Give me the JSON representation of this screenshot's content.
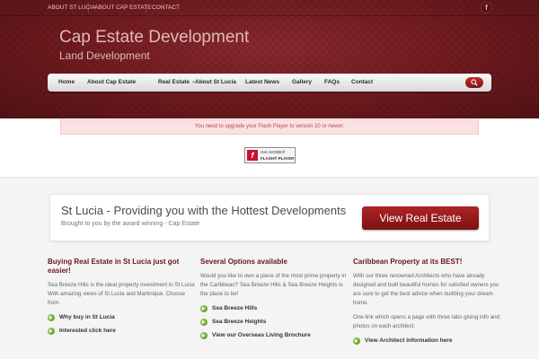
{
  "topbar": {
    "links": [
      "ABOUT ST LUCIA",
      "ABOUT CAP ESTATE",
      "CONTACT"
    ],
    "social_icon": "facebook-icon"
  },
  "site": {
    "title": "Cap Estate Development",
    "subtitle": "Land Development"
  },
  "nav": {
    "items": [
      "Home",
      "About Cap Estate",
      "Real Estate",
      "About St Lucia",
      "Latest News",
      "Gallery",
      "FAQs",
      "Contact"
    ],
    "search_icon": "search-icon"
  },
  "flash": {
    "message": "You need to upgrade your Flash Player to version 10 or newer.",
    "badge_get": "Get ADOBE®",
    "badge_name": "FLASH® PLAYER"
  },
  "promo": {
    "title": "St Lucia - Providing you with the Hottest Developments",
    "subtitle": "Brought to you by the award winning - Cap Estate",
    "button": "View Real Estate"
  },
  "columns": [
    {
      "title": "Buying Real Estate in St Lucia just got easier!",
      "paragraphs": [
        "Sea Breeze Hills is the ideal property investment in St Lucia With amazing views of St Lucia and Martinique. Choose from."
      ],
      "links": [
        "Why buy in St Lucia",
        "Interested click here"
      ]
    },
    {
      "title": "Several Options available",
      "paragraphs": [
        "Would you like to own a piece of the most prime property in the Caribbean? Sea Breeze Hills & Sea Breeze Heights is the place to be!"
      ],
      "links": [
        "Sea Breeze Hills",
        "Sea Breeze Heights",
        "View our Overseas Living Brochure"
      ]
    },
    {
      "title": "Caribbean Property at its BEST!",
      "paragraphs": [
        "With our three renowned Architects who have already designed and built beautiful homes for satisfied owners you are sure to get the best advice when building your dream home.",
        "One link which opens a page with three tabs giving info and photos on each architect."
      ],
      "links": [
        "View Architect information here"
      ]
    }
  ],
  "colors": {
    "brand_dark": "#6e1a1e",
    "accent_red": "#a01e1e",
    "link_green": "#6aaa2e"
  }
}
